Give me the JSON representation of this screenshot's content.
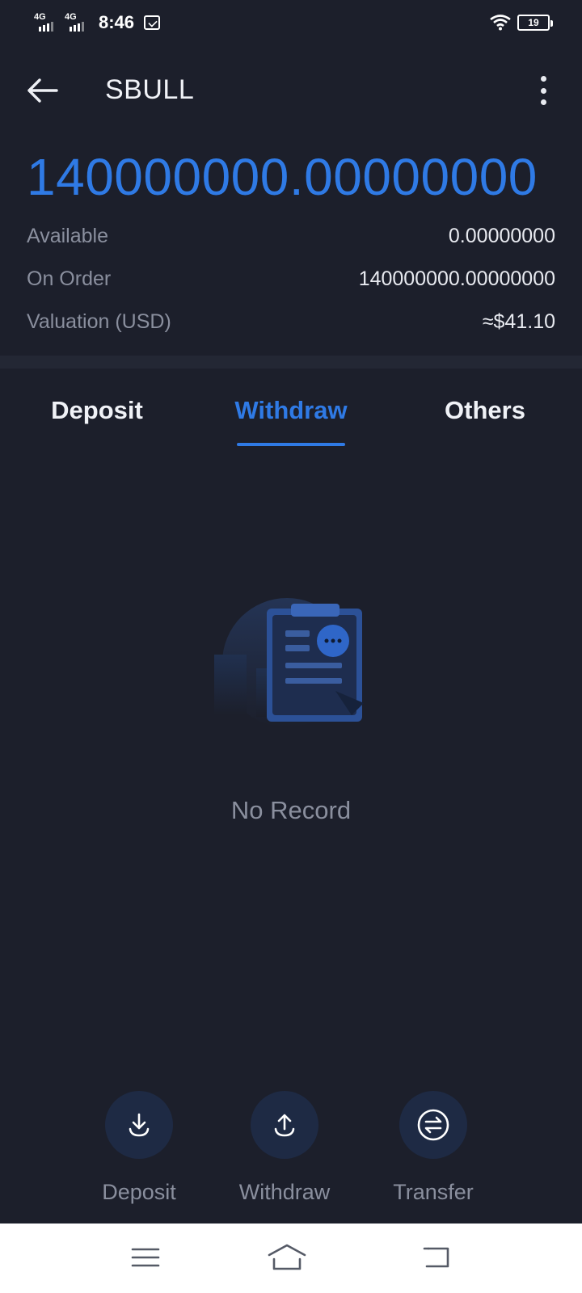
{
  "status_bar": {
    "network_1": "4G",
    "network_2": "4G",
    "time": "8:46",
    "battery": "19"
  },
  "header": {
    "title": "SBULL",
    "back_icon": "arrow-left-icon",
    "more_icon": "more-vertical-icon"
  },
  "balance": {
    "total": "140000000.00000000",
    "rows": [
      {
        "label": "Available",
        "value": "0.00000000"
      },
      {
        "label": "On Order",
        "value": "140000000.00000000"
      },
      {
        "label": "Valuation (USD)",
        "value": "≈$41.10"
      }
    ]
  },
  "tabs": [
    {
      "label": "Deposit",
      "active": false
    },
    {
      "label": "Withdraw",
      "active": true
    },
    {
      "label": "Others",
      "active": false
    }
  ],
  "empty_state": {
    "text": "No Record",
    "icon": "empty-clipboard-illustration"
  },
  "actions": [
    {
      "label": "Deposit",
      "icon": "download-icon"
    },
    {
      "label": "Withdraw",
      "icon": "upload-icon"
    },
    {
      "label": "Transfer",
      "icon": "transfer-icon"
    }
  ],
  "colors": {
    "background": "#1c1f2b",
    "accent": "#2f7ae5",
    "muted_text": "#8a8f9e"
  },
  "nav_bar": {
    "icons": [
      "menu-icon",
      "home-icon",
      "back-icon"
    ]
  }
}
